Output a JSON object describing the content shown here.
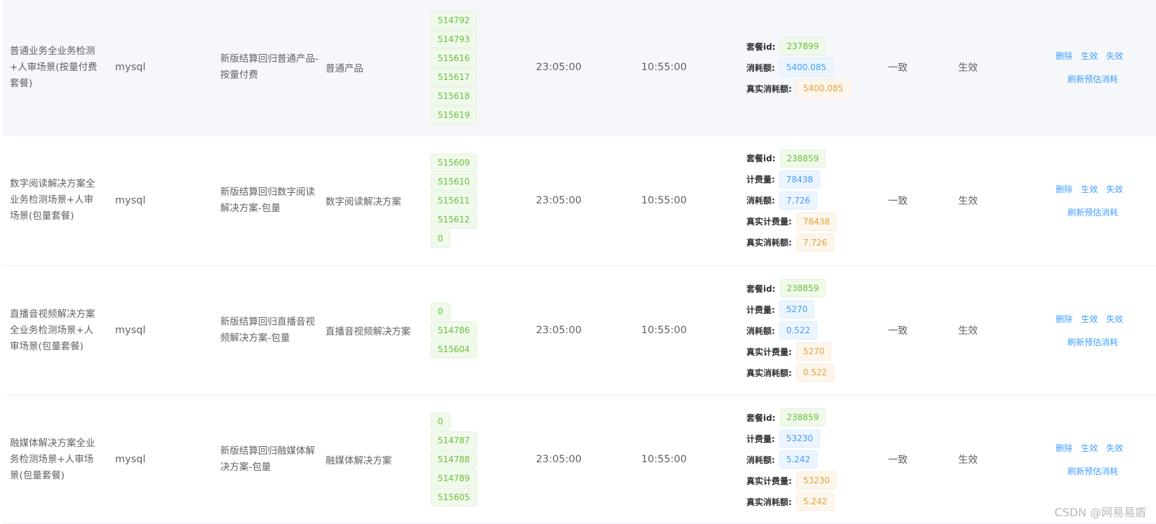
{
  "colors": {
    "link": "#409eff",
    "tag_green_text": "#67c23a",
    "tag_blue_text": "#409eff",
    "tag_orange_text": "#e6a23c",
    "row_stripe": "#f5f7fa"
  },
  "rows": [
    {
      "name": "普通业务全业务检测+人审场景(按量付费套餐)",
      "db": "mysql",
      "desc": "新版结算回归普通产品-按量付费",
      "product": "普通产品",
      "ids": [
        "514792",
        "514793",
        "515616",
        "515617",
        "515618",
        "515619"
      ],
      "start_time": "23:05:00",
      "end_time": "10:55:00",
      "package_id_label": "套餐id:",
      "package_id": "237899",
      "billing_label": "计费量:",
      "billing": "",
      "consume_label": "消耗额:",
      "consume": "5400.085",
      "real_billing_label": "真实计费量:",
      "real_billing": "",
      "real_consume_label": "真实消耗额:",
      "real_consume": "5400.085",
      "consistency": "一致",
      "status": "生效",
      "ops": {
        "delete": "删除",
        "enable": "生效",
        "disable": "失效",
        "refresh": "刷新预估消耗"
      }
    },
    {
      "name": "数字阅读解决方案全业务检测场景+人审场景(包量套餐)",
      "db": "mysql",
      "desc": "新版结算回归数字阅读解决方案-包量",
      "product": "数字阅读解决方案",
      "ids": [
        "515609",
        "515610",
        "515611",
        "515612",
        "0"
      ],
      "start_time": "23:05:00",
      "end_time": "10:55:00",
      "package_id_label": "套餐id:",
      "package_id": "238859",
      "billing_label": "计费量:",
      "billing": "78438",
      "consume_label": "消耗额:",
      "consume": "7.726",
      "real_billing_label": "真实计费量:",
      "real_billing": "78438",
      "real_consume_label": "真实消耗额:",
      "real_consume": "7.726",
      "consistency": "一致",
      "status": "生效",
      "ops": {
        "delete": "删除",
        "enable": "生效",
        "disable": "失效",
        "refresh": "刷新预估消耗"
      }
    },
    {
      "name": "直播音视频解决方案全业务检测场景+人审场景(包量套餐)",
      "db": "mysql",
      "desc": "新版结算回归直播音视频解决方案-包量",
      "product": "直播音视频解决方案",
      "ids": [
        "0",
        "514786",
        "515604"
      ],
      "start_time": "23:05:00",
      "end_time": "10:55:00",
      "package_id_label": "套餐id:",
      "package_id": "238859",
      "billing_label": "计费量:",
      "billing": "5270",
      "consume_label": "消耗额:",
      "consume": "0.522",
      "real_billing_label": "真实计费量:",
      "real_billing": "5270",
      "real_consume_label": "真实消耗额:",
      "real_consume": "0.522",
      "consistency": "一致",
      "status": "生效",
      "ops": {
        "delete": "删除",
        "enable": "生效",
        "disable": "失效",
        "refresh": "刷新预估消耗"
      }
    },
    {
      "name": "融媒体解决方案全业务检测场景+人审场景(包量套餐)",
      "db": "mysql",
      "desc": "新版结算回归融媒体解决方案-包量",
      "product": "融媒体解决方案",
      "ids": [
        "0",
        "514787",
        "514788",
        "514789",
        "515605"
      ],
      "start_time": "23:05:00",
      "end_time": "10:55:00",
      "package_id_label": "套餐id:",
      "package_id": "238859",
      "billing_label": "计费量:",
      "billing": "53230",
      "consume_label": "消耗额:",
      "consume": "5.242",
      "real_billing_label": "真实计费量:",
      "real_billing": "53230",
      "real_consume_label": "真实消耗额:",
      "real_consume": "5.242",
      "consistency": "一致",
      "status": "生效",
      "ops": {
        "delete": "删除",
        "enable": "生效",
        "disable": "失效",
        "refresh": "刷新预估消耗"
      }
    }
  ],
  "watermark": "CSDN @网易易盾"
}
